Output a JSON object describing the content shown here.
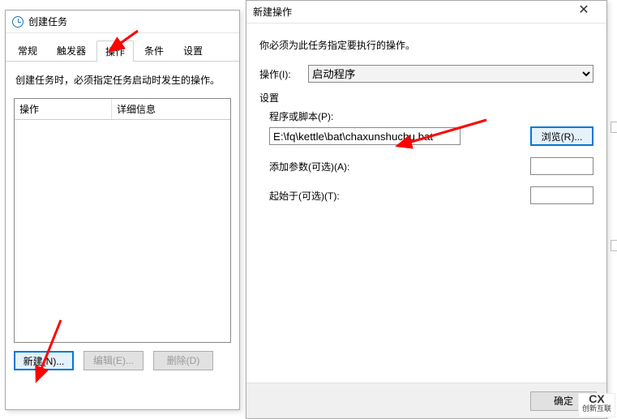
{
  "create_task_dialog": {
    "title": "创建任务",
    "tabs": [
      "常规",
      "触发器",
      "操作",
      "条件",
      "设置"
    ],
    "active_tab_index": 2,
    "description": "创建任务时，必须指定任务启动时发生的操作。",
    "table_headers": {
      "action": "操作",
      "detail": "详细信息"
    },
    "buttons": {
      "new": "新建(N)...",
      "edit": "编辑(E)...",
      "delete": "删除(D)"
    }
  },
  "new_action_dialog": {
    "title": "新建操作",
    "instruction": "你必须为此任务指定要执行的操作。",
    "operation_label": "操作(I):",
    "operation_value": "启动程序",
    "settings_label": "设置",
    "program_label": "程序或脚本(P):",
    "program_value": "E:\\fq\\kettle\\bat\\chaxunshuchu.bat",
    "browse_label": "浏览(R)...",
    "args_label": "添加参数(可选)(A):",
    "args_value": "",
    "startin_label": "起始于(可选)(T):",
    "startin_value": "",
    "ok_label": "确定"
  },
  "watermark": {
    "brand": "创新互联",
    "mark": "CX"
  }
}
